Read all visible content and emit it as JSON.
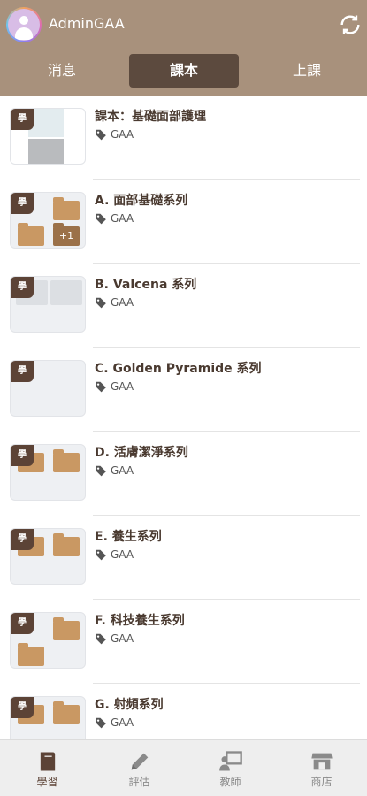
{
  "header": {
    "username": "AdminGAA",
    "tabs": [
      {
        "label": "消息"
      },
      {
        "label": "課本"
      },
      {
        "label": "上課"
      }
    ]
  },
  "courses": [
    {
      "title": "課本：基礎面部護理",
      "tag": "GAA",
      "badge": "學"
    },
    {
      "title": "A. 面部基礎系列",
      "tag": "GAA",
      "badge": "學",
      "extra": "+1"
    },
    {
      "title": "B. Valcena 系列",
      "tag": "GAA",
      "badge": "學"
    },
    {
      "title": "C. Golden Pyramide 系列",
      "tag": "GAA",
      "badge": "學"
    },
    {
      "title": "D. 活膚潔淨系列",
      "tag": "GAA",
      "badge": "學"
    },
    {
      "title": "E. 養生系列",
      "tag": "GAA",
      "badge": "學"
    },
    {
      "title": "F. 科技養生系列",
      "tag": "GAA",
      "badge": "學"
    },
    {
      "title": "G. 射頻系列",
      "tag": "GAA",
      "badge": "學"
    }
  ],
  "bottom_nav": [
    {
      "label": "學習",
      "icon": "book-icon"
    },
    {
      "label": "評估",
      "icon": "pencil-icon"
    },
    {
      "label": "教師",
      "icon": "teacher-icon"
    },
    {
      "label": "商店",
      "icon": "store-icon"
    }
  ],
  "colors": {
    "header_bg": "#a8917c",
    "active_tab": "#5c4a3e",
    "folder": "#c99863",
    "badge": "#5c4336"
  }
}
